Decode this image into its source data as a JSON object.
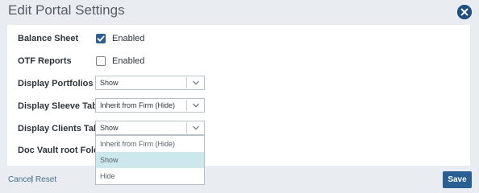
{
  "dialog": {
    "title": "Edit Portal Settings",
    "close_icon": "close-circle-icon",
    "accent_color": "#2a5f93"
  },
  "settings": {
    "balance_sheet": {
      "label": "Balance Sheet",
      "checked": true,
      "option_label": "Enabled"
    },
    "otf_reports": {
      "label": "OTF Reports",
      "checked": false,
      "option_label": "Enabled"
    },
    "display_portfolios": {
      "label": "Display Portfolios",
      "value": "Show"
    },
    "display_sleeve_tab": {
      "label": "Display Sleeve Tab",
      "value": "Inherit from Firm (Hide)"
    },
    "display_clients_tab": {
      "label": "Display Clients Tab",
      "value": "Show"
    },
    "doc_vault_root_folder": {
      "label": "Doc Vault root Folder"
    }
  },
  "dropdown": {
    "options": [
      "Inherit from Firm (Hide)",
      "Show",
      "Hide"
    ],
    "selected": "Show"
  },
  "footer": {
    "cancel_label": "Cancel",
    "separator": "|",
    "reset_label": "Reset",
    "save_label": "Save"
  }
}
